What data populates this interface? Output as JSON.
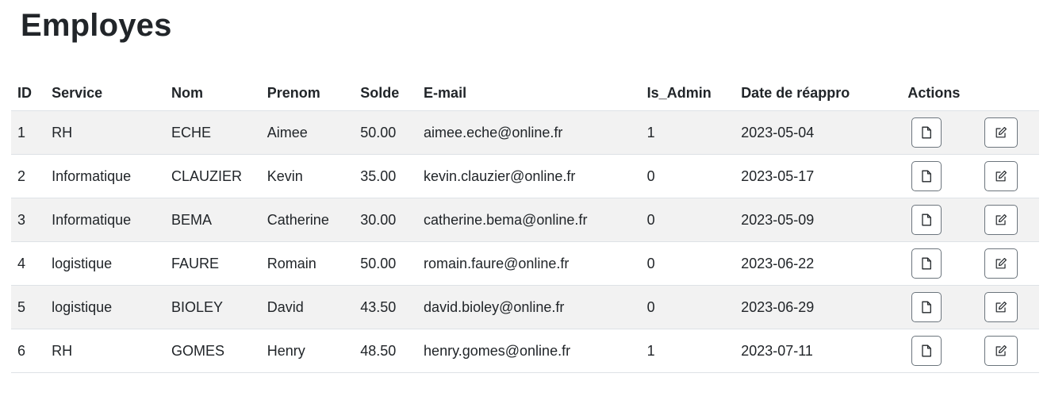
{
  "page": {
    "title": "Employes"
  },
  "table": {
    "headers": {
      "id": "ID",
      "service": "Service",
      "nom": "Nom",
      "prenom": "Prenom",
      "solde": "Solde",
      "email": "E-mail",
      "is_admin": "Is_Admin",
      "date": "Date de réappro",
      "actions": "Actions"
    },
    "rows": [
      {
        "id": "1",
        "service": "RH",
        "nom": "ECHE",
        "prenom": "Aimee",
        "solde": "50.00",
        "email": "aimee.eche@online.fr",
        "is_admin": "1",
        "date": "2023-05-04"
      },
      {
        "id": "2",
        "service": "Informatique",
        "nom": "CLAUZIER",
        "prenom": "Kevin",
        "solde": "35.00",
        "email": "kevin.clauzier@online.fr",
        "is_admin": "0",
        "date": "2023-05-17"
      },
      {
        "id": "3",
        "service": "Informatique",
        "nom": "BEMA",
        "prenom": "Catherine",
        "solde": "30.00",
        "email": "catherine.bema@online.fr",
        "is_admin": "0",
        "date": "2023-05-09"
      },
      {
        "id": "4",
        "service": "logistique",
        "nom": "FAURE",
        "prenom": "Romain",
        "solde": "50.00",
        "email": "romain.faure@online.fr",
        "is_admin": "0",
        "date": "2023-06-22"
      },
      {
        "id": "5",
        "service": "logistique",
        "nom": "BIOLEY",
        "prenom": "David",
        "solde": "43.50",
        "email": "david.bioley@online.fr",
        "is_admin": "0",
        "date": "2023-06-29"
      },
      {
        "id": "6",
        "service": "RH",
        "nom": "GOMES",
        "prenom": "Henry",
        "solde": "48.50",
        "email": "henry.gomes@online.fr",
        "is_admin": "1",
        "date": "2023-07-11"
      }
    ],
    "row_actions": {
      "view_icon": "file-icon",
      "edit_icon": "pencil-square-icon"
    }
  },
  "colors": {
    "text": "#212529",
    "stripe": "#f2f2f2",
    "border": "#dee2e6",
    "button_border": "#6c757d"
  }
}
